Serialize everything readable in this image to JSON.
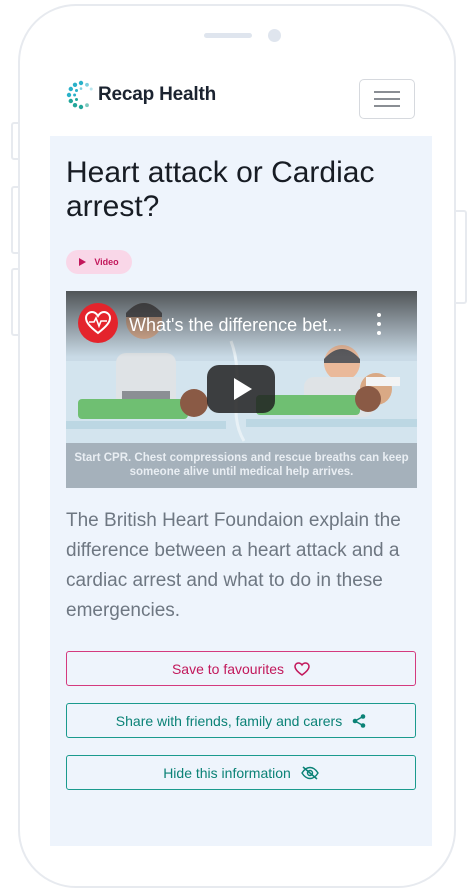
{
  "header": {
    "brand_name": "Recap Health",
    "menu_icon": "hamburger-menu-icon"
  },
  "article": {
    "title": "Heart attack or Cardiac arrest?",
    "badge_label": "Video",
    "description": "The British Heart Foundaion explain the difference between a heart attack and a cardiac arrest and what to do in these emergencies."
  },
  "video": {
    "title": "What's the difference bet...",
    "caption": "Start CPR. Chest compressions and rescue breaths can keep someone alive until medical help arrives.",
    "channel_icon": "heart-logo-icon"
  },
  "actions": {
    "favourite_label": "Save to favourites",
    "share_label": "Share with friends, family and carers",
    "hide_label": "Hide this information"
  },
  "colors": {
    "brand_teal": "#1a9a8d",
    "accent_pink": "#c2185b",
    "content_background": "#eef4fc"
  }
}
